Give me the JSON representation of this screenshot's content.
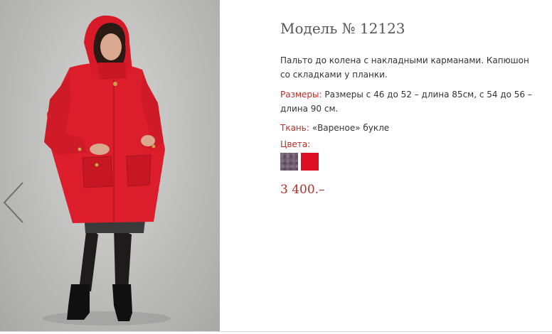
{
  "product": {
    "title": "Модель № 12123",
    "description": "Пальто до колена с накладными карманами. Капюшон со складками у планки.",
    "sizes_label": "Размеры:",
    "sizes_value": " Размеры с 46 до 52 – длина 85см, с 54 до 56 – длина 90 см.",
    "fabric_label": "Ткань:",
    "fabric_value": " «Вареное» букле",
    "colors_label": "Цвета:",
    "colors": [
      {
        "name": "boucle-purple",
        "hex": "#6d5a6b"
      },
      {
        "name": "red",
        "hex": "#dd0f25"
      }
    ],
    "price": "3 400.–"
  },
  "accent_color": "#b5302a",
  "icons": {
    "prev": "chevron-left-icon"
  }
}
